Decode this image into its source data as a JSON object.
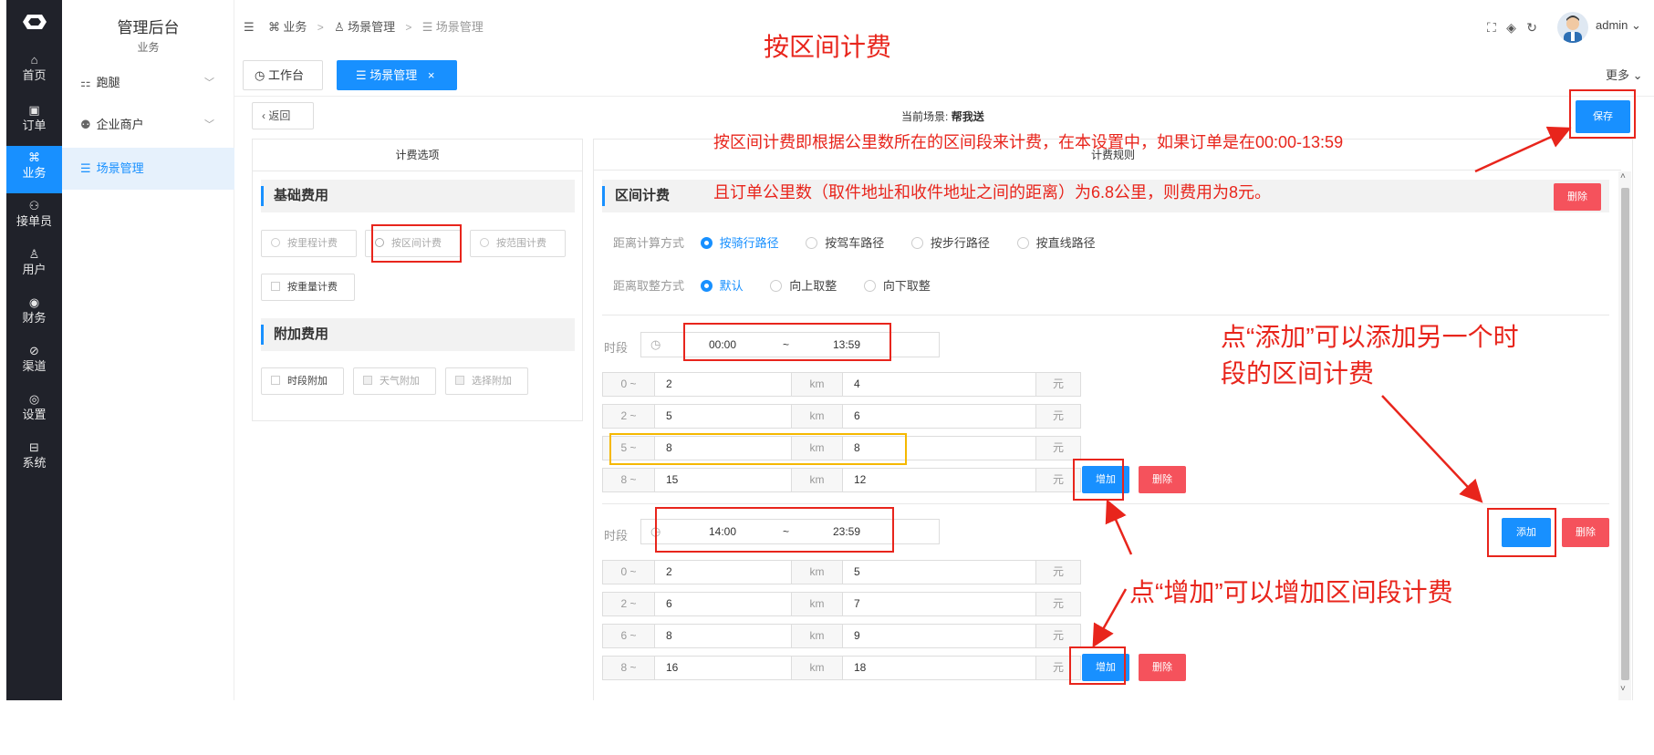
{
  "app": {
    "title": "管理后台",
    "subtitle": "业务"
  },
  "rail": [
    {
      "icon": "⌂",
      "label": "首页"
    },
    {
      "icon": "▣",
      "label": "订单"
    },
    {
      "icon": "⌘",
      "label": "业务"
    },
    {
      "icon": "⚇",
      "label": "接单员"
    },
    {
      "icon": "♙",
      "label": "用户"
    },
    {
      "icon": "◉",
      "label": "财务"
    },
    {
      "icon": "⊘",
      "label": "渠道"
    },
    {
      "icon": "◎",
      "label": "设置"
    },
    {
      "icon": "⊟",
      "label": "系统"
    }
  ],
  "sidebar": {
    "items": [
      {
        "icon": "⚏",
        "label": "跑腿"
      },
      {
        "icon": "⚉",
        "label": "企业商户"
      },
      {
        "icon": "☰",
        "label": "场景管理"
      }
    ]
  },
  "header": {
    "breadcrumb": [
      "业务",
      "场景管理",
      "场景管理"
    ],
    "user": "admin"
  },
  "tabs": {
    "workbench": "工作台",
    "scene": "场景管理",
    "close": "×",
    "more": "更多"
  },
  "toolbar": {
    "back": "返回",
    "current_scene_label": "当前场景:",
    "current_scene": "帮我送",
    "save": "保存"
  },
  "left_panel": {
    "title": "计费选项",
    "basic": "基础费用",
    "basic_options": [
      "按里程计费",
      "按区间计费",
      "按范围计费",
      "按重量计费"
    ],
    "extra": "附加费用",
    "extra_options": [
      "时段附加",
      "天气附加",
      "选择附加"
    ]
  },
  "right_panel": {
    "title": "计费规则",
    "section": "区间计费",
    "delete": "删除",
    "distance_mode_label": "距离计算方式",
    "distance_modes": [
      "按骑行路径",
      "按驾车路径",
      "按步行路径",
      "按直线路径"
    ],
    "rounding_label": "距离取整方式",
    "rounding_modes": [
      "默认",
      "向上取整",
      "向下取整"
    ],
    "period_label": "时段",
    "km": "km",
    "yuan": "元",
    "add_row": "增加",
    "add_period": "添加",
    "periods": [
      {
        "start": "00:00",
        "tilde": "~",
        "end": "13:59",
        "rows": [
          {
            "from": "0 ~",
            "to": "2",
            "price": "4"
          },
          {
            "from": "2 ~",
            "to": "5",
            "price": "6"
          },
          {
            "from": "5 ~",
            "to": "8",
            "price": "8"
          },
          {
            "from": "8 ~",
            "to": "15",
            "price": "12"
          }
        ]
      },
      {
        "start": "14:00",
        "tilde": "~",
        "end": "23:59",
        "rows": [
          {
            "from": "0 ~",
            "to": "2",
            "price": "5"
          },
          {
            "from": "2 ~",
            "to": "6",
            "price": "7"
          },
          {
            "from": "6 ~",
            "to": "8",
            "price": "9"
          },
          {
            "from": "8 ~",
            "to": "16",
            "price": "18"
          }
        ]
      }
    ]
  },
  "annotations": {
    "title": "按区间计费",
    "desc1": "按区间计费即根据公里数所在的区间段来计费，在本设置中，如果订单是在00:00-13:59",
    "desc2": "且订单公里数（取件地址和收件地址之间的距离）为6.8公里，则费用为8元。",
    "add_period_line1": "点“添加”可以添加另一个时",
    "add_period_line2": "段的区间计费",
    "add_row": "点“增加”可以增加区间段计费"
  },
  "colors": {
    "accent": "#1890ff",
    "danger": "#f5525c",
    "annotation": "#e8251c",
    "rail": "#20222a"
  }
}
